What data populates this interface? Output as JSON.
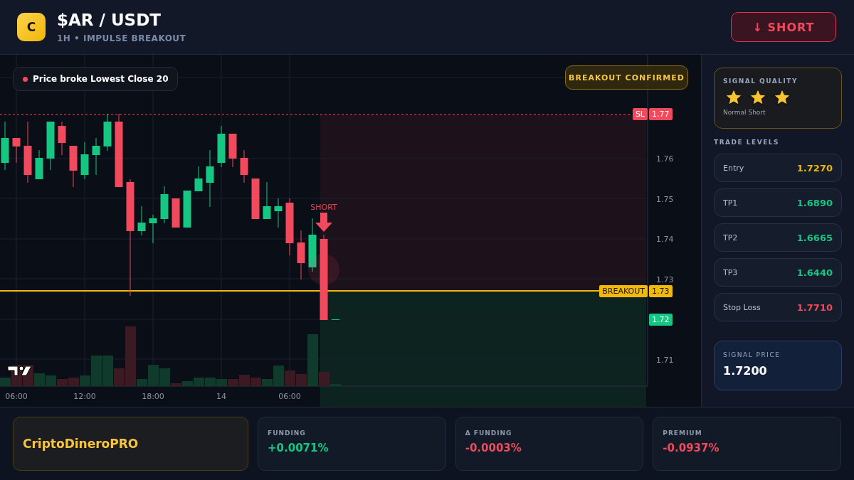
{
  "header": {
    "logo_letter": "C",
    "title": "$AR / USDT",
    "subtitle": "1H • IMPULSE BREAKOUT",
    "action_button": {
      "label": "↓ SHORT"
    }
  },
  "chart": {
    "alert_text": "Price broke Lowest Close 20",
    "status_badge": "BREAKOUT CONFIRMED",
    "signal_label": "SHORT",
    "price_labels": [
      "1.76",
      "1.75",
      "1.74",
      "1.73",
      "1.71"
    ],
    "time_labels": [
      "06:00",
      "12:00",
      "18:00",
      "14",
      "06:00"
    ],
    "markers": [
      {
        "kind": "stop",
        "tag": "SL",
        "price": "1.77"
      },
      {
        "kind": "breakout",
        "tag": "BREAKOUT",
        "price": "1.73"
      },
      {
        "kind": "current",
        "price": "1.72"
      }
    ]
  },
  "signal_quality": {
    "title": "SIGNAL QUALITY",
    "stars": 3,
    "caption": "Normal Short"
  },
  "trade_levels": {
    "title": "TRADE LEVELS",
    "rows": [
      {
        "label": "Entry",
        "value": "1.7270",
        "kind": "entry"
      },
      {
        "label": "TP1",
        "value": "1.6890",
        "kind": "target"
      },
      {
        "label": "TP2",
        "value": "1.6665",
        "kind": "target"
      },
      {
        "label": "TP3",
        "value": "1.6440",
        "kind": "target"
      },
      {
        "label": "Stop Loss",
        "value": "1.7710",
        "kind": "stop"
      }
    ]
  },
  "signal_price": {
    "label": "SIGNAL PRICE",
    "value": "1.7200"
  },
  "stats": [
    {
      "kind": "brand",
      "value": "CriptoDineroPRO"
    },
    {
      "kind": "metric",
      "label": "FUNDING",
      "value": "+0.0071%",
      "color": "#16c784"
    },
    {
      "kind": "metric",
      "label": "Δ FUNDING",
      "value": "-0.0003%",
      "color": "#f2495c"
    },
    {
      "kind": "metric",
      "label": "PREMIUM",
      "value": "-0.0937%",
      "color": "#f2495c"
    }
  ]
}
